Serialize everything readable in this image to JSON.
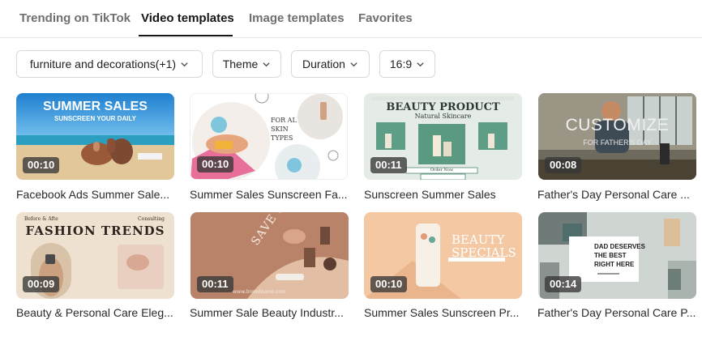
{
  "tabs": [
    {
      "label": "Trending on TikTok",
      "active": false
    },
    {
      "label": "Video templates",
      "active": true
    },
    {
      "label": "Image templates",
      "active": false
    },
    {
      "label": "Favorites",
      "active": false
    }
  ],
  "filters": [
    {
      "label": "furniture and decorations(+1)",
      "icon": "chevron-down-icon"
    },
    {
      "label": "Theme",
      "icon": "chevron-down-icon"
    },
    {
      "label": "Duration",
      "icon": "chevron-down-icon"
    },
    {
      "label": "16:9",
      "icon": "chevron-down-icon"
    }
  ],
  "templates": [
    {
      "title": "Facebook Ads Summer Sale...",
      "duration": "00:10",
      "overlay": [
        "SUMMER SALES",
        "SUNSCREEN YOUR DAILY"
      ]
    },
    {
      "title": "Summer Sales Sunscreen Fa...",
      "duration": "00:10",
      "overlay": [
        "FOR AL",
        "SKIN",
        "TYPES"
      ]
    },
    {
      "title": "Sunscreen Summer Sales",
      "duration": "00:11",
      "overlay": [
        "BEAUTY PRODUCT",
        "Natural Skincare",
        "Order Now"
      ]
    },
    {
      "title": "Father's Day Personal Care ...",
      "duration": "00:08",
      "overlay": [
        "CUSTOMIZE",
        "FOR FATHER'S DAY"
      ]
    },
    {
      "title": "Beauty & Personal Care Eleg...",
      "duration": "00:09",
      "overlay": [
        "FASHION TRENDS",
        "Before & Afte",
        "Consulting"
      ]
    },
    {
      "title": "Summer Sale Beauty Industr...",
      "duration": "00:11",
      "overlay": [
        "SAVE BIG NOW",
        "www.brandname.com"
      ]
    },
    {
      "title": "Summer Sales Sunscreen Pr...",
      "duration": "00:10",
      "overlay": [
        "BEAUTY",
        "SPECIALS"
      ]
    },
    {
      "title": "Father's Day Personal Care P...",
      "duration": "00:14",
      "overlay": [
        "DAD DESERVES",
        "THE BEST",
        "RIGHT HERE"
      ]
    }
  ]
}
